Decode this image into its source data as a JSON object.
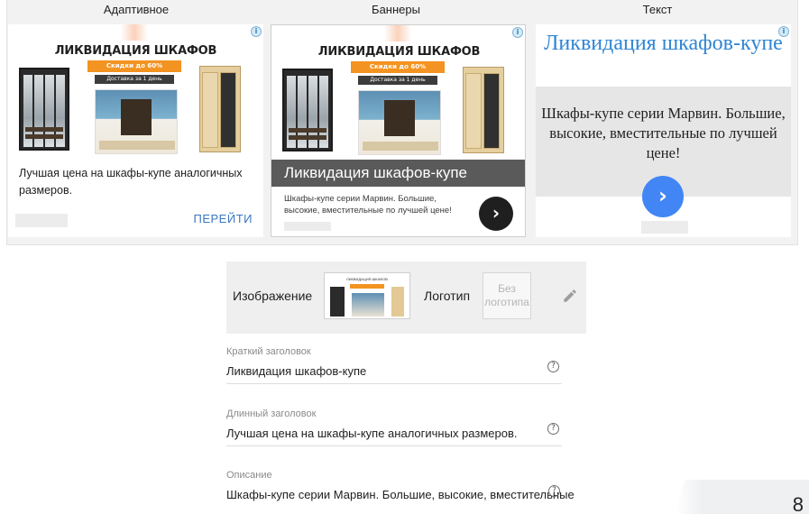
{
  "preview": {
    "tabs": [
      "Адаптивное",
      "Баннеры",
      "Текст"
    ],
    "adchoices_icon": "info-icon",
    "ad_image": {
      "title": "ЛИКВИДАЦИЯ ШКАФОВ",
      "badge": "Скидки до 60%",
      "sub": "Доставка за 1 день"
    },
    "adaptive": {
      "long_headline": "Лучшая цена на шкафы-купе аналогичных размеров.",
      "cta": "ПЕРЕЙТИ"
    },
    "banner": {
      "headline": "Ликвидация шкафов-купе",
      "description": "Шкафы-купе серии Марвин. Большие, высокие, вместительные по лучшей цене!",
      "button_icon": "chevron-right-icon"
    },
    "text": {
      "headline": "Ликвидация шкафов-купе",
      "description": "Шкафы-купе серии Марвин. Большие, высокие, вместительные по лучшей цене!",
      "button_icon": "chevron-right-icon"
    }
  },
  "media": {
    "image_label": "Изображение",
    "logo_label": "Логотип",
    "logo_placeholder": "Без логотипа",
    "thumb_title": "ЛИКВИДАЦИЯ ШКАФОВ",
    "edit_icon": "pencil-icon"
  },
  "fields": [
    {
      "label": "Краткий заголовок",
      "value": "Ликвидация шкафов-купе",
      "help_icon": "help-icon"
    },
    {
      "label": "Длинный заголовок",
      "value": "Лучшая цена на шкафы-купе аналогичных размеров.",
      "help_icon": "help-icon"
    },
    {
      "label": "Описание",
      "value": "Шкафы-купе серии Марвин. Большие, высокие, вместительные",
      "help_icon": "help-icon"
    }
  ],
  "page_number": "8"
}
